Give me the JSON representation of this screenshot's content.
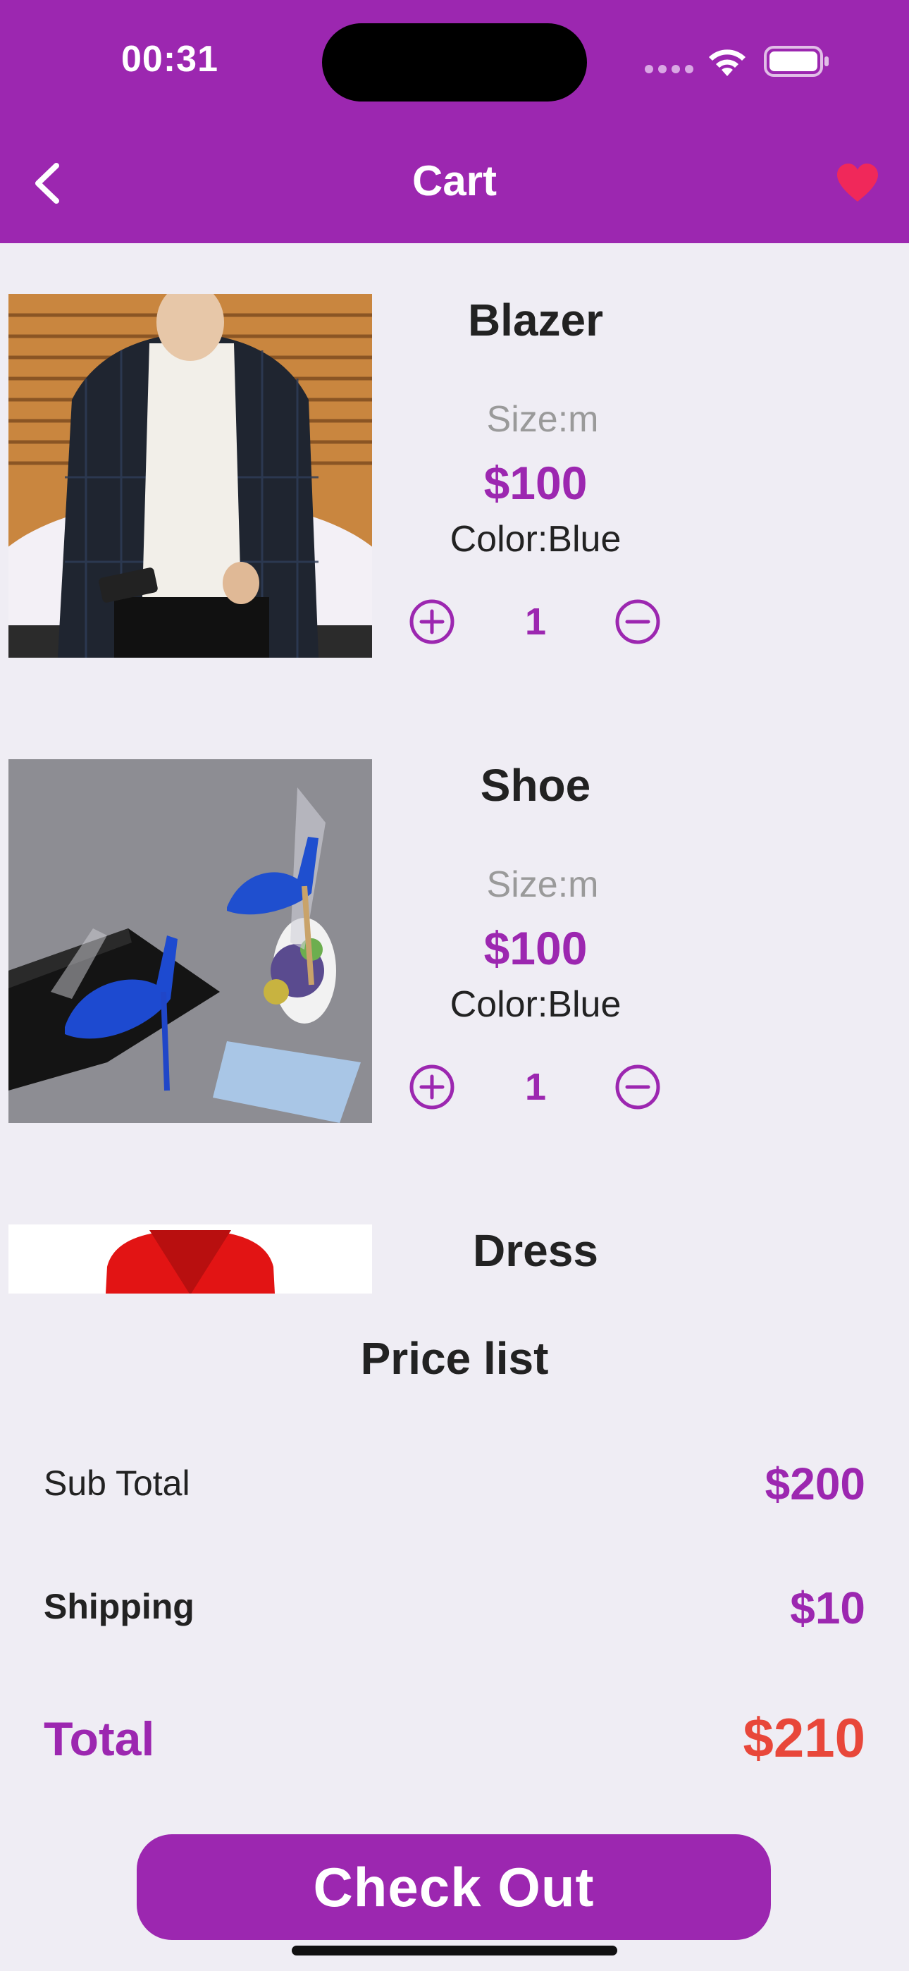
{
  "status_bar": {
    "time": "00:31"
  },
  "app_bar": {
    "title": "Cart"
  },
  "cart": {
    "items": [
      {
        "name": "Blazer",
        "size": "Size:m",
        "price": "$100",
        "color": "Color:Blue",
        "quantity": "1"
      },
      {
        "name": "Shoe",
        "size": "Size:m",
        "price": "$100",
        "color": "Color:Blue",
        "quantity": "1"
      },
      {
        "name": "Dress"
      }
    ]
  },
  "price_list": {
    "title": "Price list",
    "subtotal_label": "Sub Total",
    "subtotal_value": "$200",
    "shipping_label": "Shipping",
    "shipping_value": "$10",
    "total_label": "Total",
    "total_value": "$210"
  },
  "checkout_label": "Check Out",
  "colors": {
    "primary": "#9c27b0",
    "total": "#e8473a",
    "heart": "#f0285a",
    "background": "#efedf4"
  }
}
